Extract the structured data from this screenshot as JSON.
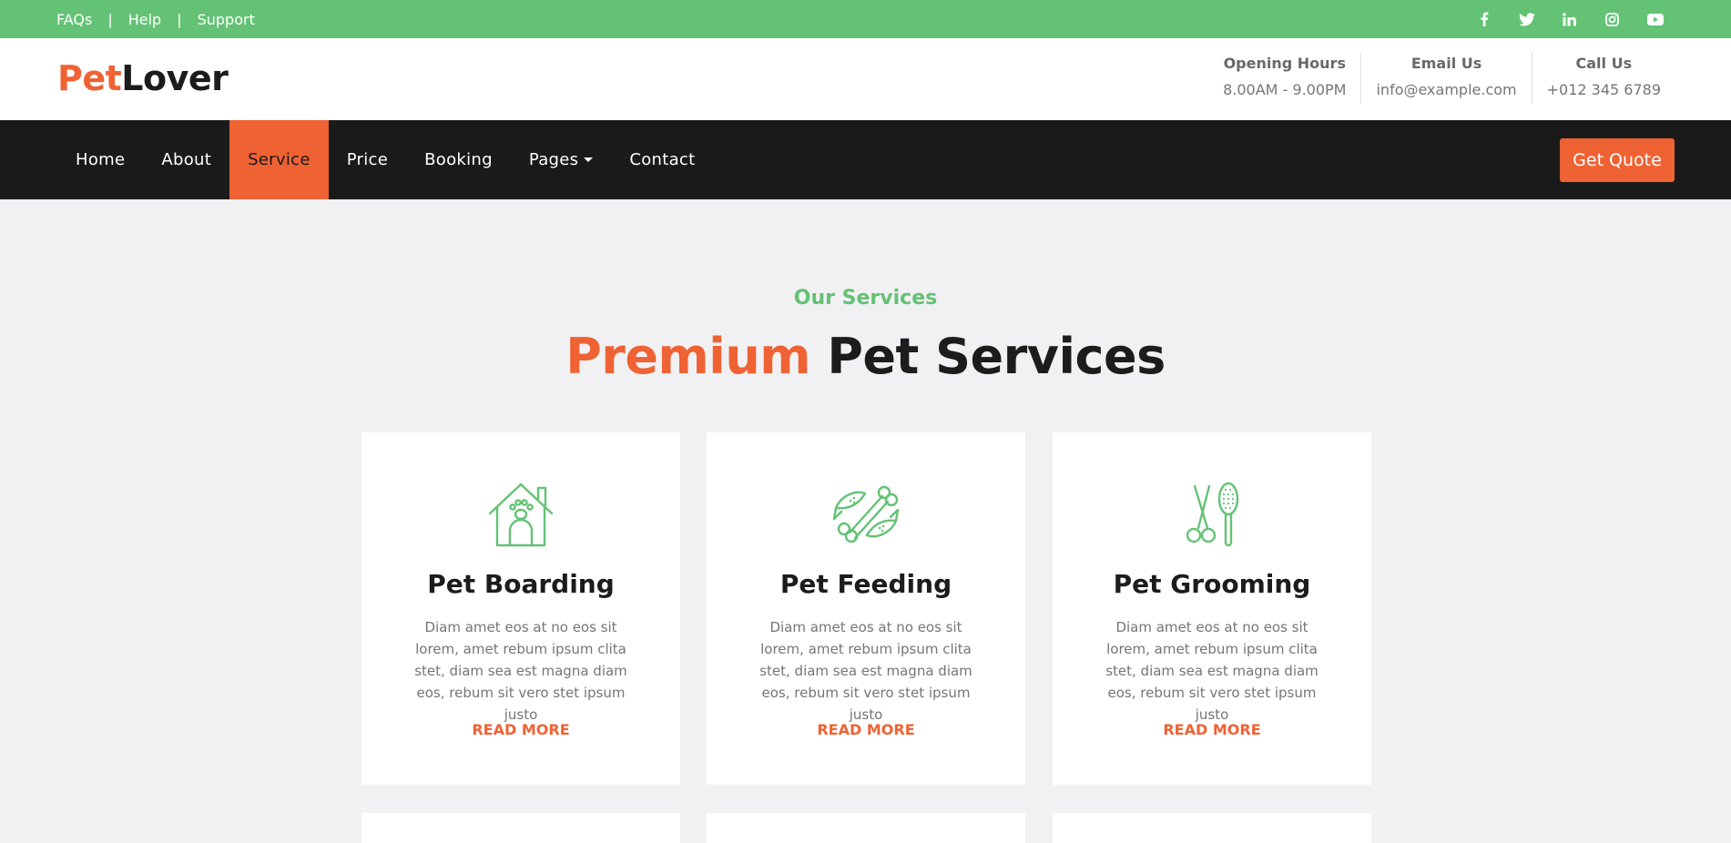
{
  "topbar": {
    "links": [
      "FAQs",
      "Help",
      "Support"
    ],
    "separator": "|",
    "social_icons": [
      "facebook-icon",
      "twitter-icon",
      "linkedin-icon",
      "instagram-icon",
      "youtube-icon"
    ]
  },
  "brand": {
    "part1": "Pet",
    "part2": "Lover"
  },
  "contact": [
    {
      "label": "Opening Hours",
      "value": "8.00AM - 9.00PM"
    },
    {
      "label": "Email Us",
      "value": "info@example.com"
    },
    {
      "label": "Call Us",
      "value": "+012 345 6789"
    }
  ],
  "nav": {
    "items": [
      "Home",
      "About",
      "Service",
      "Price",
      "Booking",
      "Pages",
      "Contact"
    ],
    "active": "Service",
    "cta": "Get Quote"
  },
  "section": {
    "subtitle": "Our Services",
    "title_highlight": "Premium",
    "title_rest": "Pet Services"
  },
  "services": [
    {
      "title": "Pet Boarding",
      "icon": "pet-house-icon",
      "text": "Diam amet eos at no eos sit lorem, amet rebum ipsum clita stet, diam sea est magna diam eos, rebum sit vero stet ipsum justo",
      "link": "READ MORE"
    },
    {
      "title": "Pet Feeding",
      "icon": "bone-fish-icon",
      "text": "Diam amet eos at no eos sit lorem, amet rebum ipsum clita stet, diam sea est magna diam eos, rebum sit vero stet ipsum justo",
      "link": "READ MORE"
    },
    {
      "title": "Pet Grooming",
      "icon": "scissors-brush-icon",
      "text": "Diam amet eos at no eos sit lorem, amet rebum ipsum clita stet, diam sea est magna diam eos, rebum sit vero stet ipsum justo",
      "link": "READ MORE"
    }
  ],
  "colors": {
    "green": "#64c275",
    "orange": "#ef6234",
    "dark": "#1a1a1a"
  }
}
